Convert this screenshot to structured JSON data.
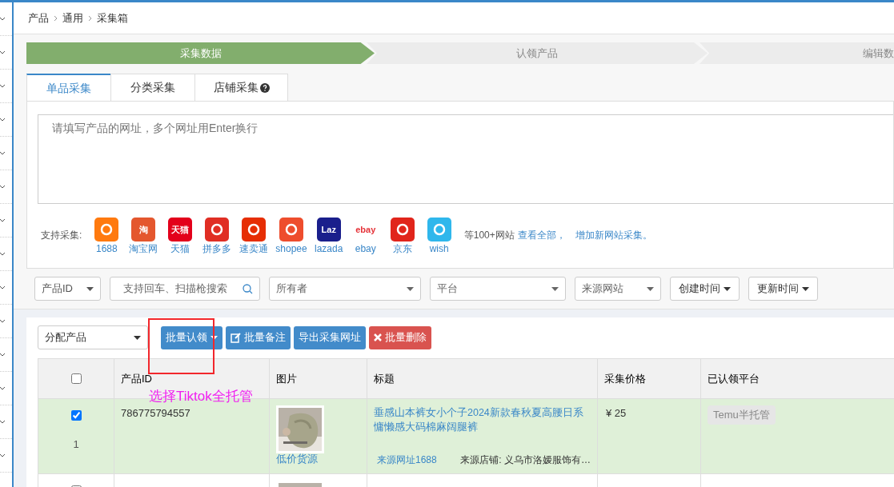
{
  "breadcrumb": [
    "产品",
    "通用",
    "采集箱"
  ],
  "steps": [
    {
      "label": "采集数据",
      "selected": true
    },
    {
      "label": "认领产品",
      "selected": false
    },
    {
      "label": "编辑数",
      "selected": false
    }
  ],
  "tabs": [
    {
      "label": "单品采集",
      "selected": true,
      "help": false
    },
    {
      "label": "分类采集",
      "selected": false,
      "help": false
    },
    {
      "label": "店铺采集",
      "selected": false,
      "help": true
    }
  ],
  "url_input": {
    "placeholder": "请填写产品的网址，多个网址用Enter换行"
  },
  "sources": {
    "label": "支持采集:",
    "sites": [
      {
        "name": "1688",
        "color": "#ff7a0f"
      },
      {
        "name": "淘宝网",
        "color": "#e4572e",
        "glyph": "淘"
      },
      {
        "name": "天猫",
        "color": "#e3001b",
        "glyph": "天猫"
      },
      {
        "name": "拼多多",
        "color": "#e02e24"
      },
      {
        "name": "速卖通",
        "color": "#e62e04"
      },
      {
        "name": "shopee",
        "color": "#ee4d2d"
      },
      {
        "name": "lazada",
        "color": "#1a1f8c",
        "glyph": "Laz"
      },
      {
        "name": "ebay",
        "color": "#ffffff",
        "glyph": "ebay"
      },
      {
        "name": "京东",
        "color": "#e1251b"
      },
      {
        "name": "wish",
        "color": "#2fb7ec"
      }
    ],
    "more_text": "等100+网站",
    "links": [
      "查看全部",
      "增加新网站采集。"
    ],
    "separator": "，"
  },
  "filters": [
    {
      "kind": "select",
      "value": "产品ID"
    },
    {
      "kind": "search",
      "placeholder": "支持回车、扫描枪搜索"
    },
    {
      "kind": "select",
      "placeholder": "所有者"
    },
    {
      "kind": "select",
      "placeholder": "平台"
    },
    {
      "kind": "select",
      "placeholder": "来源网站"
    },
    {
      "kind": "button",
      "label": "创建时间"
    },
    {
      "kind": "button",
      "label": "更新时间"
    }
  ],
  "toolbar": {
    "assign": "分配产品",
    "buttons": [
      {
        "label": "批量认领",
        "kind": "dropdown"
      },
      {
        "label": "批量备注",
        "kind": "note"
      },
      {
        "label": "导出采集网址",
        "kind": "plain"
      },
      {
        "label": "批量删除",
        "kind": "delete"
      }
    ]
  },
  "table": {
    "all_checked": false,
    "columns": [
      "产品ID",
      "图片",
      "标题",
      "采集价格",
      "已认领平台"
    ],
    "rows": [
      {
        "selected": true,
        "index": "1",
        "id": "786775794557",
        "image_link": "低价货源",
        "title": "垂感山本裤女小个子2024新款春秋夏高腰日系慵懒感大码棉麻阔腿裤",
        "source_link": "来源网址1688",
        "shop": "来源店铺: 义乌市洛嫒服饰有…",
        "price": "¥ 25",
        "platforms": [
          "Temu半托管"
        ]
      },
      {
        "selected": false
      }
    ]
  },
  "annotation": {
    "text": "选择Tiktok全托管"
  }
}
